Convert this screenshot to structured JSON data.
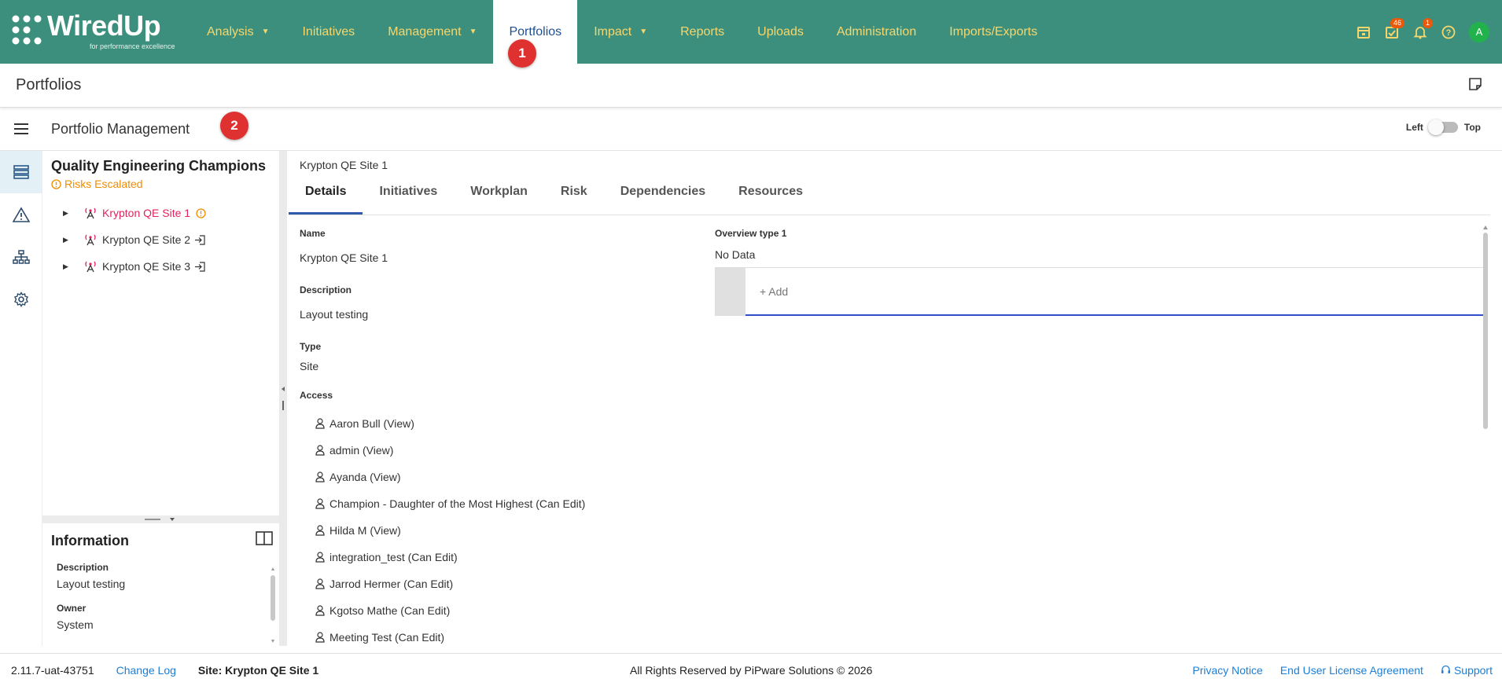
{
  "app": {
    "brand": "WiredUp",
    "tagline": "for performance excellence"
  },
  "nav": {
    "items": [
      {
        "label": "Analysis",
        "caret": true
      },
      {
        "label": "Initiatives",
        "caret": false
      },
      {
        "label": "Management",
        "caret": true
      },
      {
        "label": "Portfolios",
        "caret": false,
        "active": true
      },
      {
        "label": "Impact",
        "caret": true
      },
      {
        "label": "Reports",
        "caret": false
      },
      {
        "label": "Uploads",
        "caret": false
      },
      {
        "label": "Administration",
        "caret": false
      },
      {
        "label": "Imports/Exports",
        "caret": false
      }
    ],
    "tasks_badge": "46",
    "notifications_badge": "1",
    "avatar_initial": "A"
  },
  "markers": {
    "one": "1",
    "two": "2"
  },
  "page": {
    "title": "Portfolios"
  },
  "subheader": {
    "title": "Portfolio Management",
    "toggle_left": "Left",
    "toggle_right": "Top"
  },
  "tree": {
    "portfolio_title": "Quality Engineering Champions",
    "risk_status": "Risks Escalated",
    "nodes": [
      {
        "label": "Krypton QE Site 1",
        "selected": true,
        "status": "warning"
      },
      {
        "label": "Krypton QE Site 2",
        "selected": false,
        "status": "login"
      },
      {
        "label": "Krypton QE Site 3",
        "selected": false,
        "status": "login"
      }
    ]
  },
  "info": {
    "title": "Information",
    "description_label": "Description",
    "description_value": "Layout testing",
    "owner_label": "Owner",
    "owner_value": "System"
  },
  "content": {
    "breadcrumb": "Krypton QE Site 1",
    "tabs": [
      "Details",
      "Initiatives",
      "Workplan",
      "Risk",
      "Dependencies",
      "Resources"
    ],
    "name_label": "Name",
    "name_value": "Krypton QE Site 1",
    "description_label": "Description",
    "description_value": "Layout testing",
    "type_label": "Type",
    "type_value": "Site",
    "access_label": "Access",
    "access_list": [
      "Aaron Bull (View)",
      "admin (View)",
      "Ayanda (View)",
      "Champion - Daughter of the Most Highest (Can Edit)",
      "Hilda M (View)",
      "integration_test (Can Edit)",
      "Jarrod Hermer (Can Edit)",
      "Kgotso Mathe (Can Edit)",
      "Meeting Test (Can Edit)"
    ],
    "overview_label": "Overview type 1",
    "overview_value": "No Data",
    "add_placeholder": "+ Add"
  },
  "footer": {
    "version": "2.11.7-uat-43751",
    "changelog": "Change Log",
    "site": "Site: Krypton QE Site 1",
    "rights": "All Rights Reserved by PiPware Solutions © 2026",
    "privacy": "Privacy Notice",
    "eula": "End User License Agreement",
    "support": "Support"
  },
  "colors": {
    "nav_bg": "#3c8f7c",
    "nav_text": "#f5d76e",
    "accent_blue": "#2e5aac",
    "selected_pink": "#e0245e",
    "warning_orange": "#f08c00",
    "marker_red": "#e03131"
  }
}
